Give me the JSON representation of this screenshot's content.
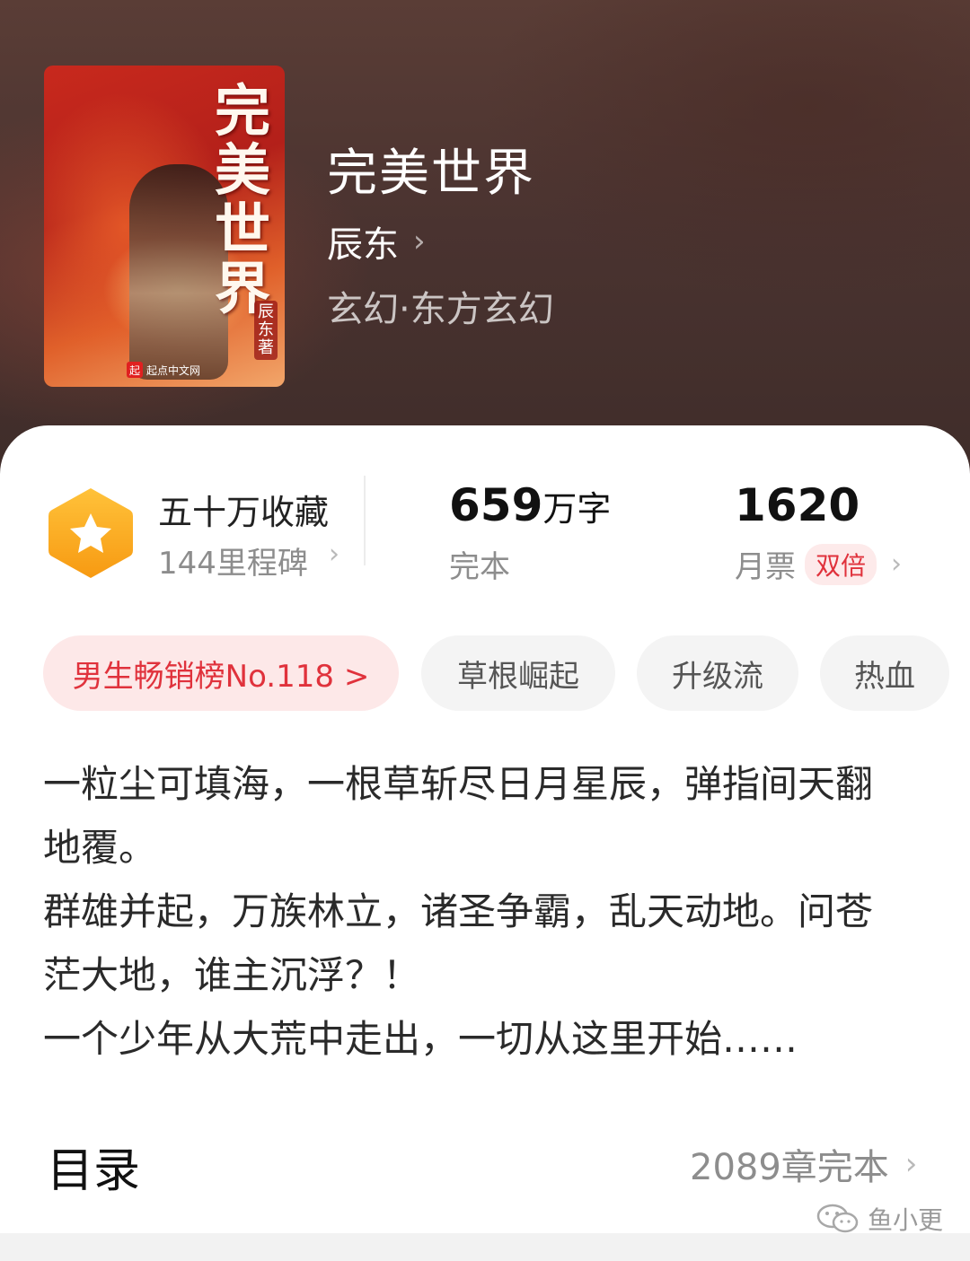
{
  "book": {
    "title": "完美世界",
    "author": "辰东",
    "genre": "玄幻·东方玄幻",
    "cover": {
      "title_chars": "完美世界",
      "author_tag": "辰东著",
      "publisher": "起点中文网",
      "publisher_badge": "起"
    }
  },
  "stats": {
    "favorites": "五十万收藏",
    "milestones": "144里程碑",
    "word_count_num": "659",
    "word_count_unit": "万字",
    "status": "完本",
    "monthly_votes": "1620",
    "monthly_votes_label": "月票",
    "double_badge": "双倍"
  },
  "tags": [
    {
      "label": "男生畅销榜No.118 >"
    },
    {
      "label": "草根崛起"
    },
    {
      "label": "升级流"
    },
    {
      "label": "热血"
    }
  ],
  "description": [
    "一粒尘可填海，一根草斩尽日月星辰，弹指间天翻地覆。",
    "群雄并起，万族林立，诸圣争霸，乱天动地。问苍茫大地，谁主沉浮？！",
    "一个少年从大荒中走出，一切从这里开始……"
  ],
  "toc": {
    "title": "目录",
    "info": "2089章完本"
  },
  "watermark": "鱼小更",
  "colors": {
    "accent_red": "#e0323c",
    "badge_orange": "#f7a21b"
  }
}
